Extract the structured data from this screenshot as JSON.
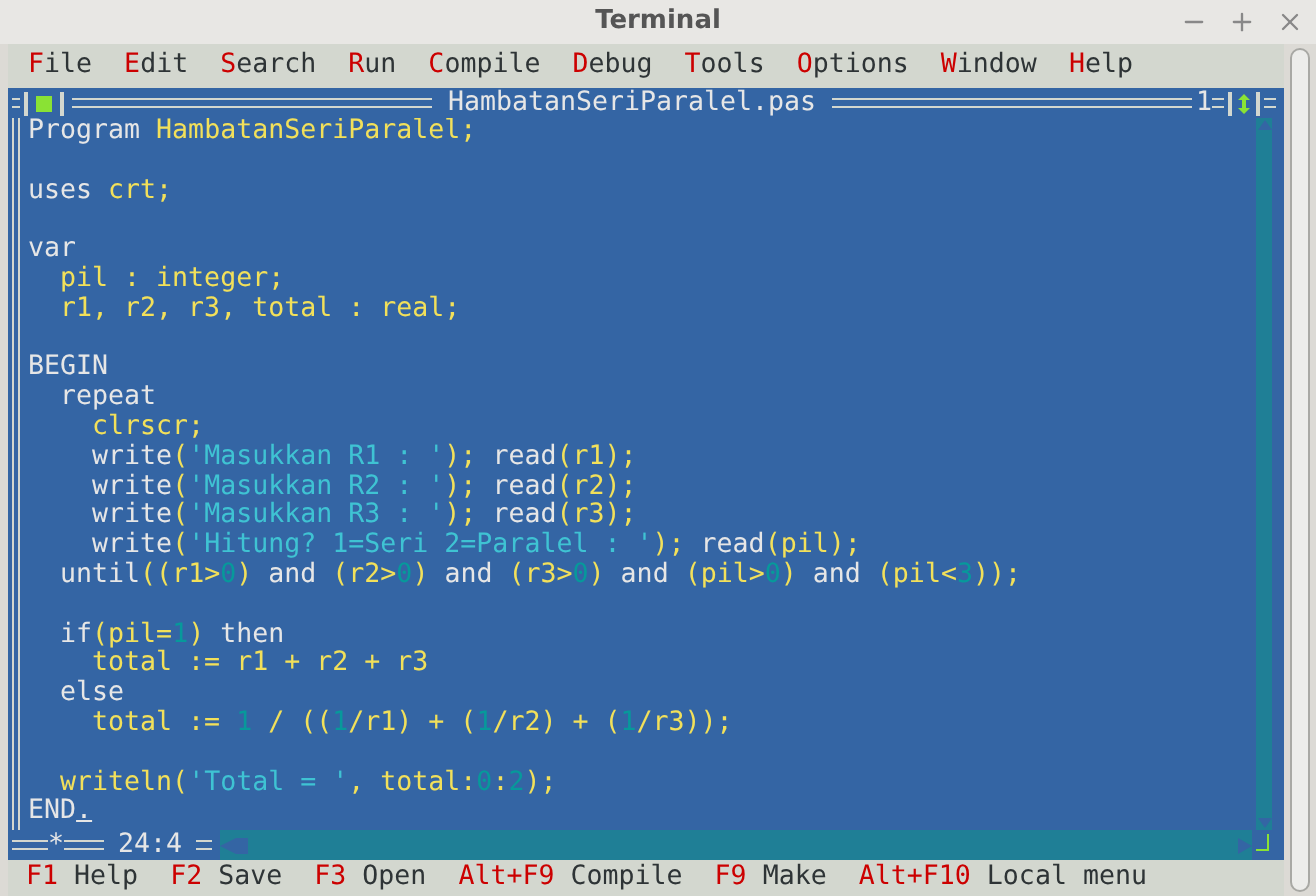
{
  "window": {
    "title": "Terminal"
  },
  "menu": [
    {
      "label": "File"
    },
    {
      "label": "Edit"
    },
    {
      "label": "Search"
    },
    {
      "label": "Run"
    },
    {
      "label": "Compile"
    },
    {
      "label": "Debug"
    },
    {
      "label": "Tools"
    },
    {
      "label": "Options"
    },
    {
      "label": "Window"
    },
    {
      "label": "Help"
    }
  ],
  "editor": {
    "file_name": "HambatanSeriParalel.pas",
    "window_number": "1",
    "modified_mark": "*",
    "cursor_position": "24:4",
    "lines": [
      {
        "tokens": [
          {
            "text": "Program ",
            "kind": "keyword"
          },
          {
            "text": "HambatanSeriParalel;",
            "kind": "ident"
          }
        ]
      },
      {
        "kind": "blank"
      },
      {
        "tokens": [
          {
            "text": "uses ",
            "kind": "keyword"
          },
          {
            "text": "crt;",
            "kind": "ident"
          }
        ]
      },
      {
        "kind": "blank"
      },
      {
        "tokens": [
          {
            "text": "var",
            "kind": "keyword"
          }
        ]
      },
      {
        "tokens": [
          {
            "text": "  pil : integer;",
            "kind": "ident"
          }
        ]
      },
      {
        "tokens": [
          {
            "text": "  r1, r2, r3, total : real;",
            "kind": "ident"
          }
        ]
      },
      {
        "kind": "blank"
      },
      {
        "tokens": [
          {
            "text": "BEGIN",
            "kind": "keyword"
          }
        ]
      },
      {
        "tokens": [
          {
            "text": "  repeat",
            "kind": "keyword"
          }
        ]
      },
      {
        "tokens": [
          {
            "text": "    clrscr;",
            "kind": "ident"
          }
        ]
      },
      {
        "tokens": [
          {
            "text": "    write",
            "kind": "keyword"
          },
          {
            "text": "(",
            "kind": "ident"
          },
          {
            "text": "'Masukkan R1 : '",
            "kind": "string"
          },
          {
            "text": "); ",
            "kind": "ident"
          },
          {
            "text": "read",
            "kind": "keyword"
          },
          {
            "text": "(r1);",
            "kind": "ident"
          }
        ]
      },
      {
        "tokens": [
          {
            "text": "    write",
            "kind": "keyword"
          },
          {
            "text": "(",
            "kind": "ident"
          },
          {
            "text": "'Masukkan R2 : '",
            "kind": "string"
          },
          {
            "text": "); ",
            "kind": "ident"
          },
          {
            "text": "read",
            "kind": "keyword"
          },
          {
            "text": "(r2);",
            "kind": "ident"
          }
        ]
      },
      {
        "tokens": [
          {
            "text": "    write",
            "kind": "keyword"
          },
          {
            "text": "(",
            "kind": "ident"
          },
          {
            "text": "'Masukkan R3 : '",
            "kind": "string"
          },
          {
            "text": "); ",
            "kind": "ident"
          },
          {
            "text": "read",
            "kind": "keyword"
          },
          {
            "text": "(r3);",
            "kind": "ident"
          }
        ]
      },
      {
        "tokens": [
          {
            "text": "    write",
            "kind": "keyword"
          },
          {
            "text": "(",
            "kind": "ident"
          },
          {
            "text": "'Hitung? 1=Seri 2=Paralel : '",
            "kind": "string"
          },
          {
            "text": "); ",
            "kind": "ident"
          },
          {
            "text": "read",
            "kind": "keyword"
          },
          {
            "text": "(pil);",
            "kind": "ident"
          }
        ]
      },
      {
        "tokens": [
          {
            "text": "  until",
            "kind": "keyword"
          },
          {
            "text": "((r1>",
            "kind": "ident"
          },
          {
            "text": "0",
            "kind": "number"
          },
          {
            "text": ")",
            "kind": "ident"
          },
          {
            "text": " and ",
            "kind": "keyword"
          },
          {
            "text": "(r2>",
            "kind": "ident"
          },
          {
            "text": "0",
            "kind": "number"
          },
          {
            "text": ")",
            "kind": "ident"
          },
          {
            "text": " and ",
            "kind": "keyword"
          },
          {
            "text": "(r3>",
            "kind": "ident"
          },
          {
            "text": "0",
            "kind": "number"
          },
          {
            "text": ")",
            "kind": "ident"
          },
          {
            "text": " and ",
            "kind": "keyword"
          },
          {
            "text": "(pil>",
            "kind": "ident"
          },
          {
            "text": "0",
            "kind": "number"
          },
          {
            "text": ")",
            "kind": "ident"
          },
          {
            "text": " and ",
            "kind": "keyword"
          },
          {
            "text": "(pil<",
            "kind": "ident"
          },
          {
            "text": "3",
            "kind": "number"
          },
          {
            "text": "));",
            "kind": "ident"
          }
        ]
      },
      {
        "kind": "blank"
      },
      {
        "tokens": [
          {
            "text": "  if",
            "kind": "keyword"
          },
          {
            "text": "(pil=",
            "kind": "ident"
          },
          {
            "text": "1",
            "kind": "number"
          },
          {
            "text": ")",
            "kind": "ident"
          },
          {
            "text": " then",
            "kind": "keyword"
          }
        ]
      },
      {
        "tokens": [
          {
            "text": "    total := r1 + r2 + r3",
            "kind": "ident"
          }
        ]
      },
      {
        "tokens": [
          {
            "text": "  else",
            "kind": "keyword"
          }
        ]
      },
      {
        "tokens": [
          {
            "text": "    total := ",
            "kind": "ident"
          },
          {
            "text": "1",
            "kind": "number"
          },
          {
            "text": " / ((",
            "kind": "ident"
          },
          {
            "text": "1",
            "kind": "number"
          },
          {
            "text": "/r1) + (",
            "kind": "ident"
          },
          {
            "text": "1",
            "kind": "number"
          },
          {
            "text": "/r2) + (",
            "kind": "ident"
          },
          {
            "text": "1",
            "kind": "number"
          },
          {
            "text": "/r3));",
            "kind": "ident"
          }
        ]
      },
      {
        "kind": "blank"
      },
      {
        "tokens": [
          {
            "text": "  writeln(",
            "kind": "ident"
          },
          {
            "text": "'Total = '",
            "kind": "string"
          },
          {
            "text": ", total:",
            "kind": "ident"
          },
          {
            "text": "0",
            "kind": "number"
          },
          {
            "text": ":",
            "kind": "ident"
          },
          {
            "text": "2",
            "kind": "number"
          },
          {
            "text": ");",
            "kind": "ident"
          }
        ]
      },
      {
        "tokens": [
          {
            "text": "END",
            "kind": "keyword"
          },
          {
            "text": ".",
            "kind": "cursor"
          }
        ]
      }
    ]
  },
  "status_bar": [
    {
      "key": "F1",
      "label": "Help"
    },
    {
      "key": "F2",
      "label": "Save"
    },
    {
      "key": "F3",
      "label": "Open"
    },
    {
      "key": "Alt+F9",
      "label": "Compile"
    },
    {
      "key": "F9",
      "label": "Make"
    },
    {
      "key": "Alt+F10",
      "label": "Local menu"
    }
  ]
}
